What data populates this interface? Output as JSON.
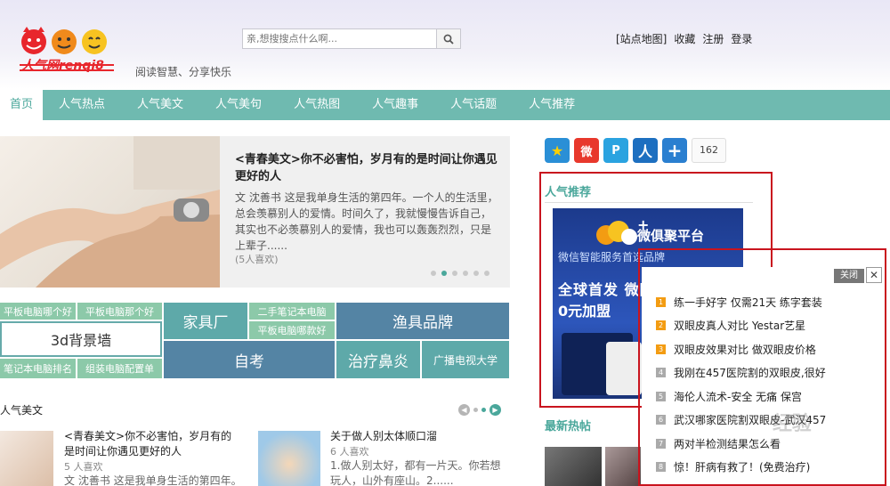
{
  "header": {
    "logo_text": "人气网renqi8",
    "tagline": "阅读智慧、分享快乐",
    "search_placeholder": "亲,想搜搜点什么啊...",
    "top_links": [
      "[站点地图]",
      "收藏",
      "注册",
      "登录"
    ]
  },
  "nav": {
    "items": [
      "首页",
      "人气热点",
      "人气美文",
      "人气美句",
      "人气热图",
      "人气趣事",
      "人气话题",
      "人气推荐"
    ],
    "active_index": 0
  },
  "feature": {
    "title": "<青春美文>你不必害怕，岁月有的是时间让你遇见更好的人",
    "desc": "文 沈善书 这是我单身生活的第四年。一个人的生活里，总会羡慕别人的爱情。时间久了，我就慢慢告诉自己，其实也不必羡慕别人的爱情，我也可以轰轰烈烈，只是上辈子......",
    "likes": "(5人喜欢)",
    "slide_count": 6,
    "active_slide": 1
  },
  "tags": [
    "平板电脑哪个好",
    "平板电脑那个好",
    "家具厂",
    "二手笔记本电脑",
    "渔具品牌",
    "3d背景墙",
    "平板电脑哪款好",
    "笔记本电脑排名",
    "组装电脑配置单",
    "自考",
    "治疗鼻炎",
    "广播电视大学"
  ],
  "section": {
    "title": "人气美文",
    "articles": [
      {
        "title": "<青春美文>你不必害怕，岁月有的是时间让你遇见更好的人",
        "likes": "5 人喜欢",
        "desc": "文 沈善书 这是我单身生活的第四年。"
      },
      {
        "title": "关于做人别太体顺口溜",
        "likes": "6 人喜欢",
        "desc": "1.做人别太好，都有一片天。你若想玩人，山外有座山。2......"
      }
    ]
  },
  "share": {
    "count": "162",
    "icons": [
      "qzone-icon",
      "weibo-icon",
      "tencent-weibo-icon",
      "renren-icon",
      "more-share-icon"
    ]
  },
  "right": {
    "rec_title": "人气推荐",
    "ad": {
      "line1": "微俱聚平台",
      "line2": "微信智能服务首选品牌",
      "line3": "全球首发 微网站第三代",
      "line4": "0元加盟"
    },
    "hot_title": "最新热帖"
  },
  "popup": {
    "close_label": "关闭",
    "x_label": "✕",
    "items": [
      "练一手好字 仅需21天 练字套装",
      "双眼皮真人对比 Yestar艺星",
      "双眼皮效果对比 做双眼皮价格",
      "我刚在457医院割的双眼皮,很好",
      "海伦人流术-安全 无痛 保宫",
      "武汉哪家医院割双眼皮-武汉457",
      "两对半检测结果怎么看",
      "惊！肝病有救了！(免费治疗)"
    ]
  },
  "watermark": "经验",
  "colors": {
    "nav_bg": "#6fbab0",
    "accent": "#4aa79b",
    "annotation_red": "#c9141e",
    "rank_top": "#f39c12"
  }
}
